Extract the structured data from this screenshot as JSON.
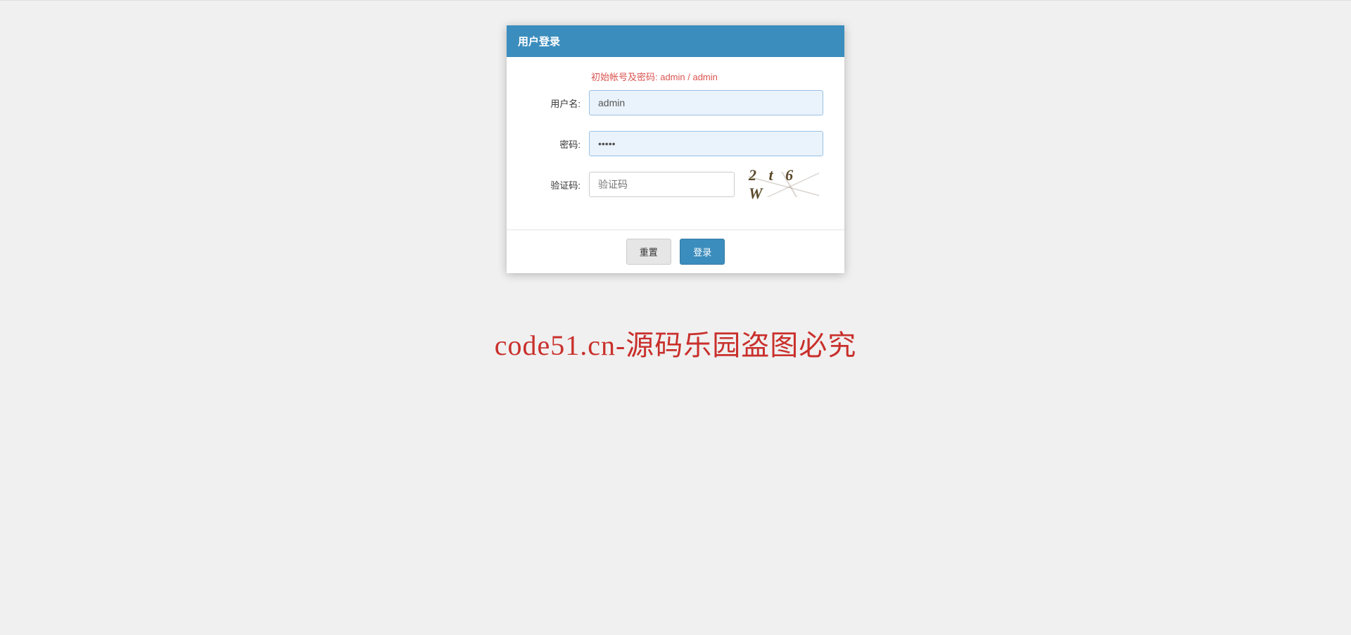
{
  "panel": {
    "title": "用户登录",
    "hint": "初始帐号及密码: admin  /  admin"
  },
  "form": {
    "username_label": "用户名:",
    "username_value": "admin",
    "password_label": "密码:",
    "password_value": "•••••",
    "captcha_label": "验证码:",
    "captcha_placeholder": "验证码",
    "captcha_value": "",
    "captcha_image_text": "2 t 6 W"
  },
  "buttons": {
    "reset": "重置",
    "login": "登录"
  },
  "watermark": "code51.cn-源码乐园盗图必究"
}
